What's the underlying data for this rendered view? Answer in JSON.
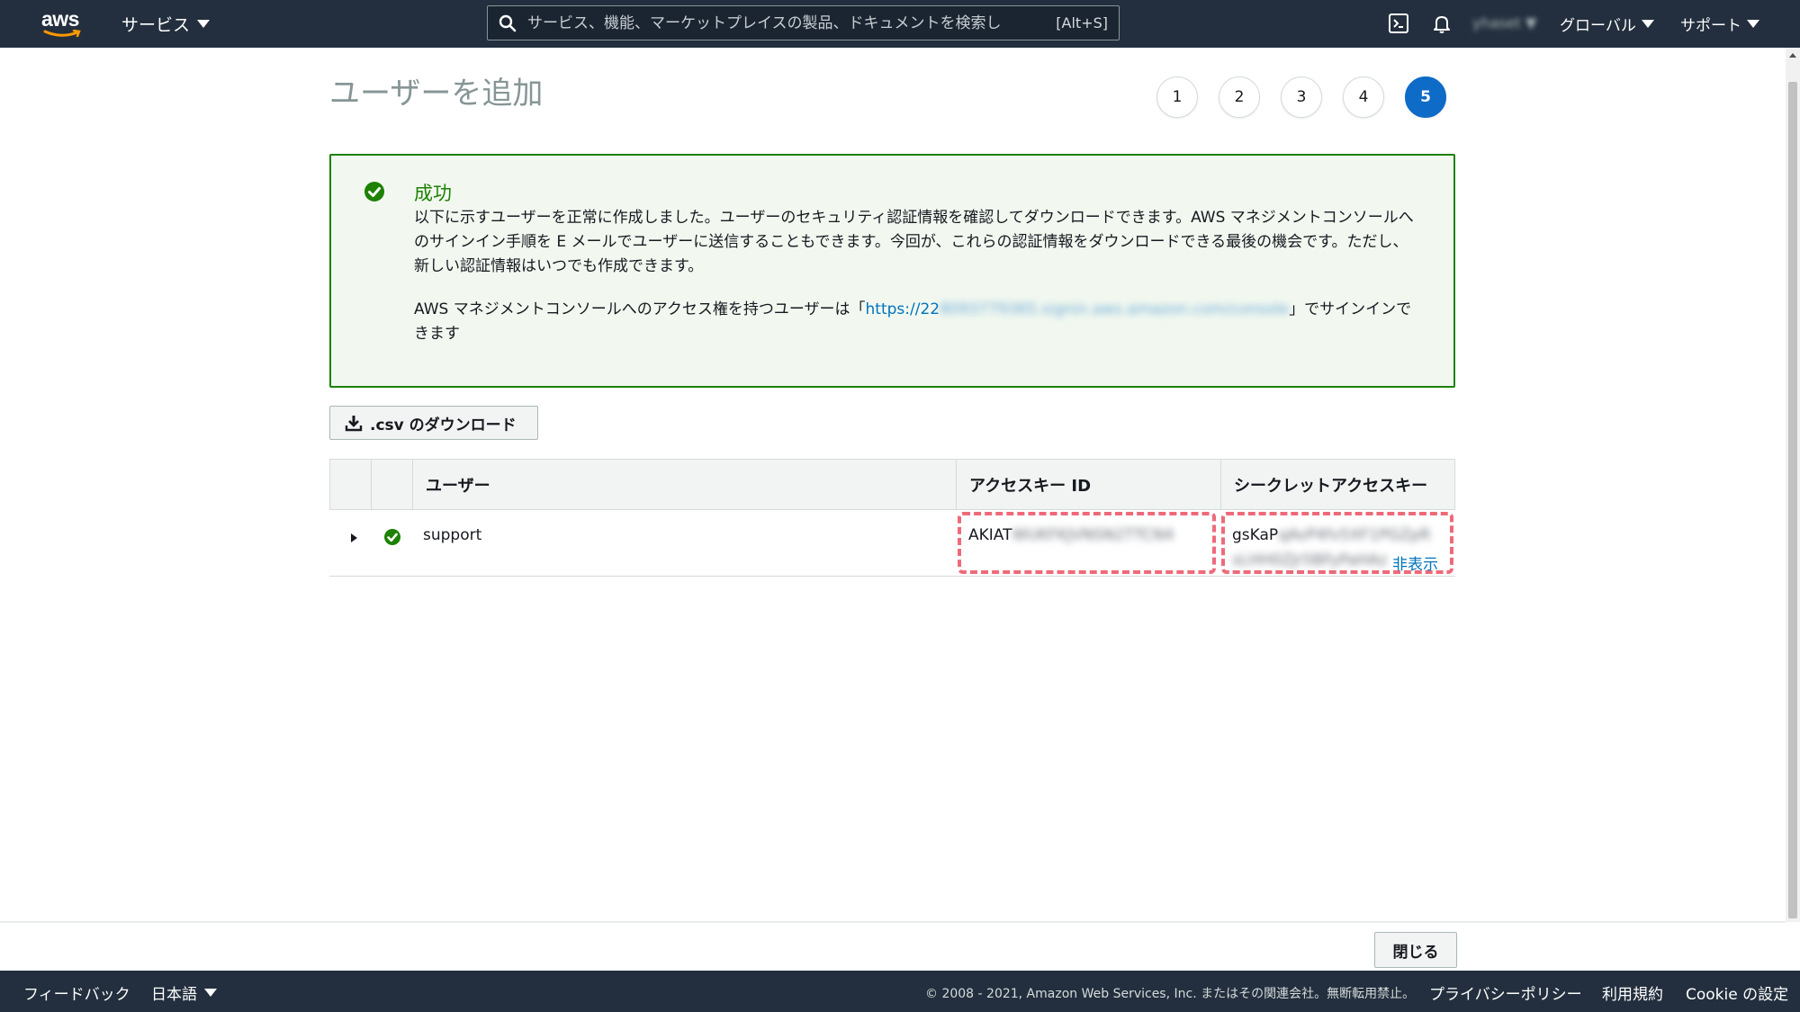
{
  "topnav": {
    "logo_text": "aws",
    "services_label": "サービス",
    "search_placeholder": "サービス、機能、マーケットプレイスの製品、ドキュメントを検索し",
    "search_shortcut": "[Alt+S]",
    "user_label": "yhaset",
    "region_label": "グローバル",
    "support_label": "サポート"
  },
  "page": {
    "title": "ユーザーを追加",
    "steps": [
      "1",
      "2",
      "3",
      "4",
      "5"
    ],
    "active_step": 5
  },
  "alert": {
    "title": "成功",
    "message": "以下に示すユーザーを正常に作成しました。ユーザーのセキュリティ認証情報を確認してダウンロードできます。AWS マネジメントコンソールへのサインイン手順を E メールでユーザーに送信することもできます。今回が、これらの認証情報をダウンロードできる最後の機会です。ただし、新しい認証情報はいつでも作成できます。",
    "signin_prefix": "AWS マネジメントコンソールへのアクセス権を持つユーザーは「",
    "signin_url_visible": "https://22",
    "signin_url_blurred": "8093779365.signin.aws.amazon.com/console",
    "signin_suffix": "」でサインインできます"
  },
  "actions": {
    "download_csv_label": ".csv のダウンロード",
    "close_label": "閉じる"
  },
  "table": {
    "columns": [
      "ユーザー",
      "アクセスキー ID",
      "シークレットアクセスキー"
    ],
    "rows": [
      {
        "user": "support",
        "access_key_visible": "AKIAT",
        "access_key_blurred": "WUKFKJVNSN2TTCN4",
        "secret_visible": "gsKaP",
        "secret_blurred_1": "qAvP4fv5XF1PGZpR",
        "secret_blurred_2": "sLHH0ZJr5BFyPaHAz",
        "hide_label": "非表示"
      }
    ]
  },
  "footer": {
    "feedback": "フィードバック",
    "language": "日本語",
    "copyright": "© 2008 - 2021, Amazon Web Services, Inc. またはその関連会社。無断転用禁止。",
    "privacy": "プライバシーポリシー",
    "terms": "利用規約",
    "cookie": "Cookie の設定"
  },
  "colors": {
    "nav_bg": "#232f3e",
    "success": "#1d8102",
    "alert_bg": "#f2f8f0",
    "active_step": "#0e6bc7",
    "link": "#0073bb",
    "highlight_dash": "#ee6a7a"
  }
}
